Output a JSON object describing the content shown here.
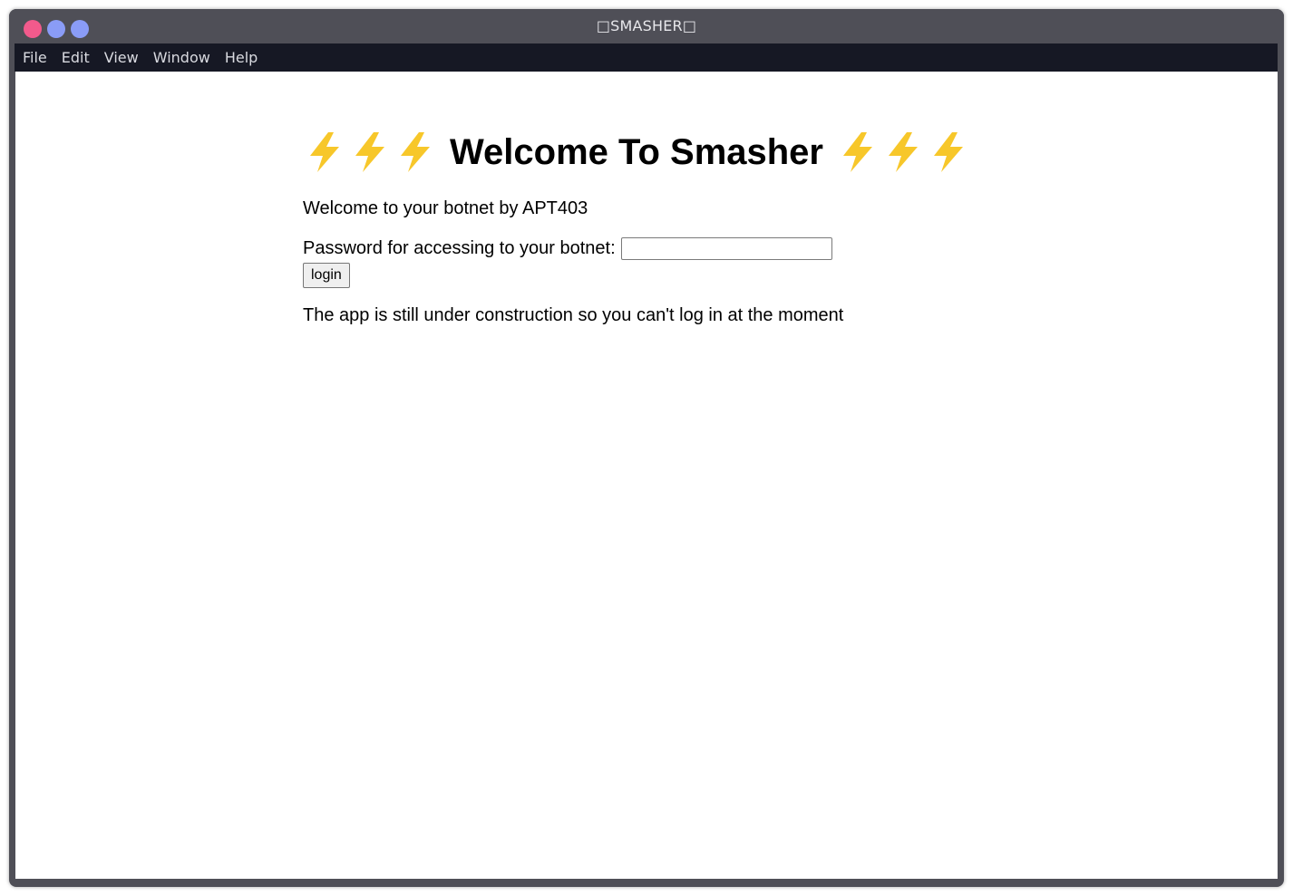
{
  "window": {
    "title": "□SMASHER□",
    "controls": {
      "close_color": "#f25a8c",
      "minimize_color": "#8a9cf7",
      "maximize_color": "#8a9cf7"
    }
  },
  "menubar": {
    "items": [
      "File",
      "Edit",
      "View",
      "Window",
      "Help"
    ]
  },
  "page": {
    "heading": "Welcome To Smasher",
    "heading_decoration_icon": "lightning-bolt-icon",
    "bolt_color": "#f7c72a",
    "subtitle": "Welcome to your botnet by APT403",
    "password_label": "Password for accessing to your botnet:",
    "password_value": "",
    "login_label": "login",
    "notice": "The app is still under construction so you can't log in at the moment"
  }
}
